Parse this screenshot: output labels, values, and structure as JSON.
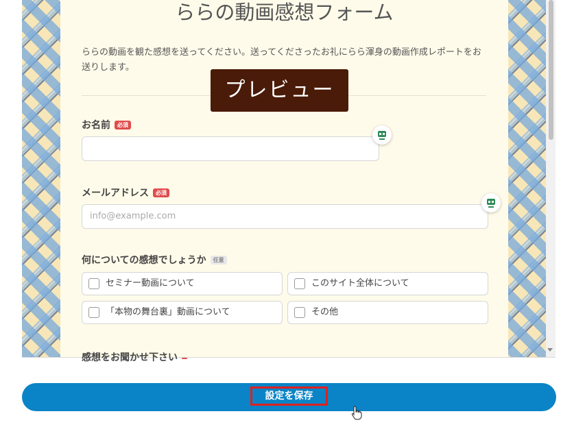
{
  "form": {
    "title": "ららの動画感想フォーム",
    "intro": "ららの動画を観た感想を送ってください。送ってくださったお礼にらら渾身の動画作成レポートをお送りします。",
    "preview_label": "プレビュー",
    "fields": [
      {
        "label": "お名前",
        "badge": "必須",
        "value": "",
        "placeholder": ""
      },
      {
        "label": "メールアドレス",
        "badge": "必須",
        "value": "",
        "placeholder": "info@example.com"
      }
    ],
    "question": {
      "label": "何についての感想でしょうか",
      "badge": "任意",
      "options": [
        "セミナー動画について",
        "このサイト全体について",
        "「本物の舞台裏」動画について",
        "その他"
      ]
    },
    "next_label_partial": "感想をお聞かせ下さい"
  },
  "footer": {
    "save_label": "設定を保存"
  },
  "icons": {
    "field_assist": "robot-icon",
    "cursor": "hand-pointer-icon"
  },
  "colors": {
    "save_button": "#0a84c6",
    "preview_bg": "#4a1b08",
    "required_badge": "#e04b4b",
    "highlight_border": "#e02020"
  }
}
